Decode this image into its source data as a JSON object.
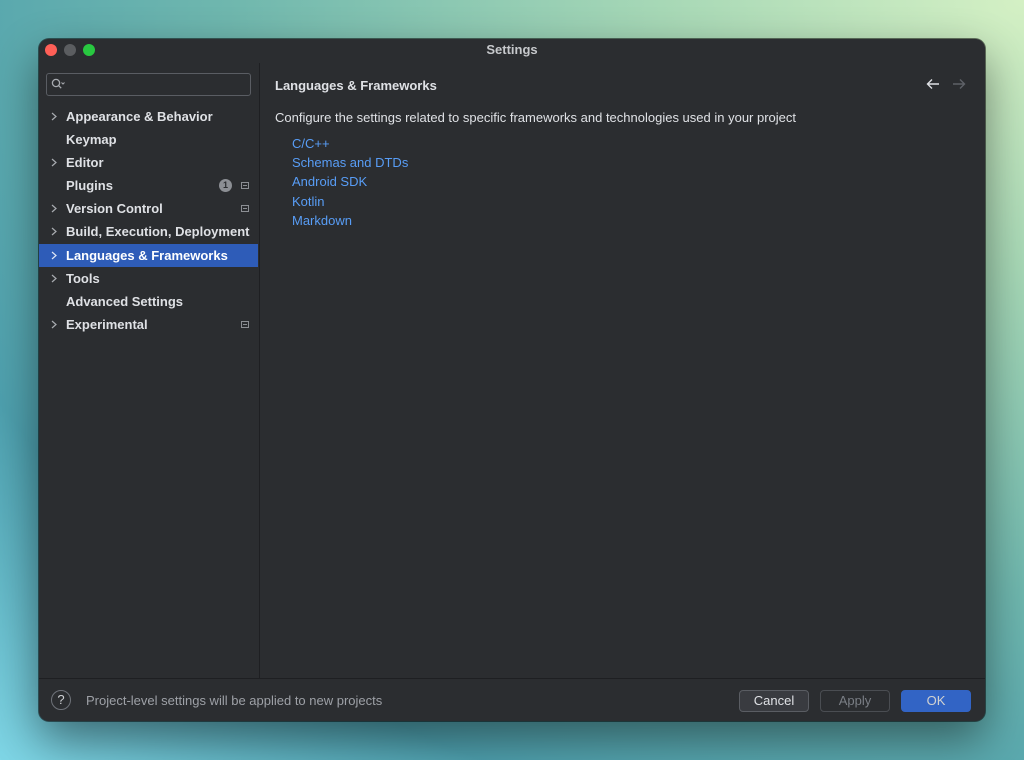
{
  "window": {
    "title": "Settings"
  },
  "search": {
    "placeholder": ""
  },
  "sidebar": {
    "items": [
      {
        "label": "Appearance & Behavior",
        "expandable": true
      },
      {
        "label": "Keymap",
        "expandable": false
      },
      {
        "label": "Editor",
        "expandable": true
      },
      {
        "label": "Plugins",
        "expandable": false,
        "badge": "1",
        "project_icon": true
      },
      {
        "label": "Version Control",
        "expandable": true,
        "project_icon": true
      },
      {
        "label": "Build, Execution, Deployment",
        "expandable": true
      },
      {
        "label": "Languages & Frameworks",
        "expandable": true,
        "selected": true
      },
      {
        "label": "Tools",
        "expandable": true
      },
      {
        "label": "Advanced Settings",
        "expandable": false
      },
      {
        "label": "Experimental",
        "expandable": true,
        "project_icon": true
      }
    ]
  },
  "main": {
    "breadcrumb": "Languages & Frameworks",
    "description": "Configure the settings related to specific frameworks and technologies used in your project",
    "links": [
      "C/C++",
      "Schemas and DTDs",
      "Android SDK",
      "Kotlin",
      "Markdown"
    ]
  },
  "footer": {
    "help_label": "?",
    "text": "Project-level settings will be applied to new projects",
    "cancel_label": "Cancel",
    "apply_label": "Apply",
    "ok_label": "OK"
  },
  "colors": {
    "accent": "#3574f0",
    "selection": "#2e5cb8",
    "link": "#589df6",
    "background": "#2b2d30"
  },
  "icons": {
    "search": "search-icon",
    "chevron": "chevron-right-icon",
    "back": "arrow-left-icon",
    "forward": "arrow-right-icon",
    "project_level": "project-level-icon",
    "help": "help-icon"
  }
}
